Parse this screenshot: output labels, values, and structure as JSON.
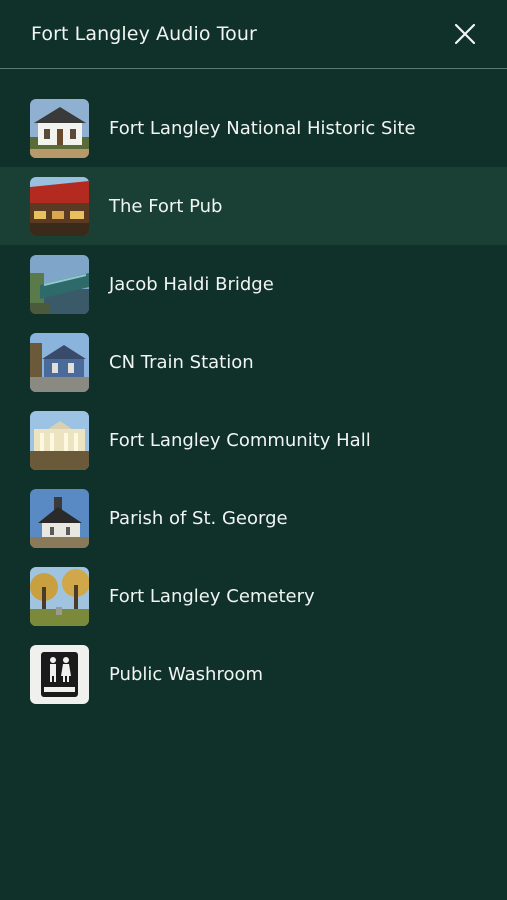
{
  "header": {
    "title": "Fort Langley Audio Tour",
    "close_icon": "close-icon"
  },
  "tour_stops": [
    {
      "label": "Fort Langley National Historic Site",
      "thumbnail": "historic-site-thumbnail"
    },
    {
      "label": "The Fort Pub",
      "thumbnail": "pub-thumbnail",
      "selected": true
    },
    {
      "label": "Jacob Haldi Bridge",
      "thumbnail": "bridge-thumbnail"
    },
    {
      "label": "CN Train Station",
      "thumbnail": "train-station-thumbnail"
    },
    {
      "label": "Fort Langley Community Hall",
      "thumbnail": "community-hall-thumbnail"
    },
    {
      "label": "Parish of St. George",
      "thumbnail": "church-thumbnail"
    },
    {
      "label": "Fort Langley Cemetery",
      "thumbnail": "cemetery-thumbnail"
    },
    {
      "label": "Public Washroom",
      "thumbnail": "washroom-sign-thumbnail"
    }
  ],
  "colors": {
    "background": "#10302a",
    "selected_row": "#1a4036",
    "text": "#f1f5f2",
    "divider": "#5c7a72"
  }
}
